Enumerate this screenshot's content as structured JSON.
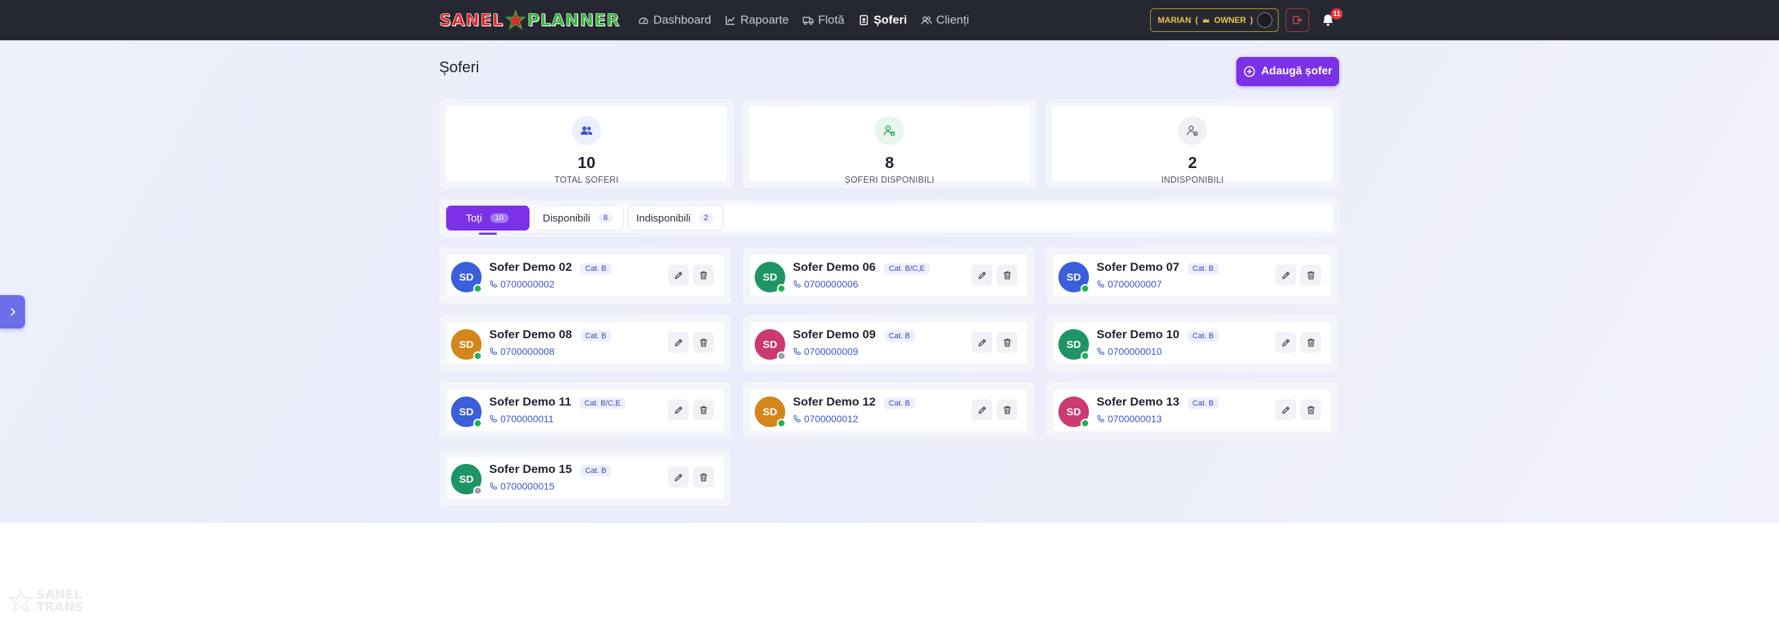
{
  "brand": {
    "part1": "SANEL",
    "part2": "PLANNER"
  },
  "nav": [
    {
      "label": "Dashboard",
      "icon": "dashboard-icon",
      "active": false
    },
    {
      "label": "Rapoarte",
      "icon": "chart-line-icon",
      "active": false
    },
    {
      "label": "Flotă",
      "icon": "truck-icon",
      "active": false
    },
    {
      "label": "Șoferi",
      "icon": "id-badge-icon",
      "active": true
    },
    {
      "label": "Clienți",
      "icon": "users-icon",
      "active": false
    }
  ],
  "user": {
    "name": "MARIAN",
    "role": "OWNER",
    "role_icon": "crown-icon"
  },
  "notifications": {
    "count": "11"
  },
  "page": {
    "title": "Șoferi",
    "add_button": "Adaugă șofer"
  },
  "stats": [
    {
      "value": "10",
      "label": "TOTAL ȘOFERI",
      "icon": "users-icon",
      "color": "#3d55c9",
      "icon_bg": "#eceffe"
    },
    {
      "value": "8",
      "label": "ȘOFERI DISPONIBILI",
      "icon": "user-check-icon",
      "color": "#25a35a",
      "icon_bg": "#e8f7ee"
    },
    {
      "value": "2",
      "label": "INDISPONIBILI",
      "icon": "user-clock-icon",
      "color": "#6b7080",
      "icon_bg": "#f0f1f4"
    }
  ],
  "tabs": [
    {
      "label": "Toți",
      "count": "10",
      "active": true
    },
    {
      "label": "Disponibili",
      "count": "8",
      "active": false
    },
    {
      "label": "Indisponibili",
      "count": "2",
      "active": false
    }
  ],
  "drivers": [
    {
      "initials": "SD",
      "name": "Sofer Demo 02",
      "category": "Cat. B",
      "phone": "0700000002",
      "avatar_color": "#3a5fd9",
      "available": true
    },
    {
      "initials": "SD",
      "name": "Sofer Demo 06",
      "category": "Cat. B/C,E",
      "phone": "0700000006",
      "avatar_color": "#1f9466",
      "available": true
    },
    {
      "initials": "SD",
      "name": "Sofer Demo 07",
      "category": "Cat. B",
      "phone": "0700000007",
      "avatar_color": "#3a5fd9",
      "available": true
    },
    {
      "initials": "SD",
      "name": "Sofer Demo 08",
      "category": "Cat. B",
      "phone": "0700000008",
      "avatar_color": "#d4861b",
      "available": true
    },
    {
      "initials": "SD",
      "name": "Sofer Demo 09",
      "category": "Cat. B",
      "phone": "0700000009",
      "avatar_color": "#cc3a72",
      "available": false
    },
    {
      "initials": "SD",
      "name": "Sofer Demo 10",
      "category": "Cat. B",
      "phone": "0700000010",
      "avatar_color": "#1f9466",
      "available": true
    },
    {
      "initials": "SD",
      "name": "Sofer Demo 11",
      "category": "Cat. B/C,E",
      "phone": "0700000011",
      "avatar_color": "#3a5fd9",
      "available": true
    },
    {
      "initials": "SD",
      "name": "Sofer Demo 12",
      "category": "Cat. B",
      "phone": "0700000012",
      "avatar_color": "#d4861b",
      "available": true
    },
    {
      "initials": "SD",
      "name": "Sofer Demo 13",
      "category": "Cat. B",
      "phone": "0700000013",
      "avatar_color": "#cc3a72",
      "available": true
    },
    {
      "initials": "SD",
      "name": "Sofer Demo 15",
      "category": "Cat. B",
      "phone": "0700000015",
      "avatar_color": "#1f9466",
      "available": false
    }
  ],
  "status_colors": {
    "available": "#22b35a",
    "unavailable": "#9aa0ad"
  },
  "watermark": {
    "line1": "SANEL",
    "line2": "TRANS"
  }
}
